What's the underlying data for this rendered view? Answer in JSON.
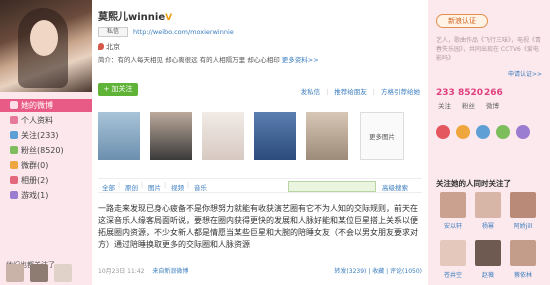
{
  "left": {
    "nav": [
      {
        "label": "她的微博",
        "active": true,
        "color": "#ffffff"
      },
      {
        "label": "个人资料",
        "active": false,
        "color": "#e7799b"
      },
      {
        "label": "关注(233)",
        "active": false,
        "color": "#5ea0d6"
      },
      {
        "label": "粉丝(8520)",
        "active": false,
        "color": "#7ebd5b"
      },
      {
        "label": "微群(0)",
        "active": false,
        "color": "#f0a63f"
      },
      {
        "label": "相册(2)",
        "active": false,
        "color": "#e3687c"
      },
      {
        "label": "游戏(1)",
        "active": false,
        "color": "#9a7cd0"
      }
    ],
    "follow_title": "他们也都关注了"
  },
  "profile": {
    "name": "莫熙儿winnie",
    "verified_mark": "V",
    "message_button": "私信",
    "url": "http://weibo.com/moxierwinnie",
    "location": "北京",
    "intro": "简介：有的人每天相见 却心离很远 有的人相隔万里 却心心相印",
    "more_info": "更多资料>>",
    "follow_button": "+ 加关注",
    "actions": [
      "发私信",
      "推荐给朋友",
      "方格引荐给她"
    ]
  },
  "photos": {
    "thumb_colors": [
      "#6c8faf",
      "#3a3a3a",
      "#d7c9c2",
      "#2b4b7c",
      "#9c8b78"
    ],
    "more_label": "更多图片"
  },
  "tabs": {
    "items": [
      "全部",
      "原创",
      "图片",
      "视频",
      "音乐"
    ],
    "search_placeholder": "",
    "search_button": "高级搜索"
  },
  "post": {
    "text": "一路走来发现已身心疲备不是你想努力就能有收获演艺圈有它不为人知的交际规则，前天在这深音乐人缘客局面听说，要想在圈内获得更快的发展和人脉好能和某位巨星搭上关系以便拓展圈内资源，不少女新人都是情愿当某些巨星和大腕的陪睡女友（不会以男女朋友要求对方）通过陪睡换取更多的交际圈和人脉资源",
    "time": "10月23日 11:42",
    "source": "来自新浪微博",
    "stats": "转发(3239) | 收藏 | 评论(1050)"
  },
  "right": {
    "badge": "新浪认证",
    "desc": "艺人，歌曲作品《飞行三味》，电视《青春失乐园》，共同出现在 CCTV6《爱电影吗》",
    "apply": "申请认证>>",
    "stats": [
      {
        "num": "233",
        "label": "关注"
      },
      {
        "num": "8520",
        "label": "粉丝"
      },
      {
        "num": "266",
        "label": "微博"
      }
    ],
    "icon_colors": [
      "#e4575f",
      "#f0a63f",
      "#5ea0d6",
      "#7ebd5b",
      "#9a7cd0"
    ],
    "section_title": "关注她的人同时关注了",
    "people": [
      {
        "name": "安以轩",
        "color": "#caa08e"
      },
      {
        "name": "杨幂",
        "color": "#d7b6a8"
      },
      {
        "name": "阿娇jill",
        "color": "#b98a78"
      },
      {
        "name": "苍井空",
        "color": "#e3c8bb"
      },
      {
        "name": "赵薇",
        "color": "#6f5a52"
      },
      {
        "name": "蔡依林",
        "color": "#c49c8a"
      }
    ]
  }
}
